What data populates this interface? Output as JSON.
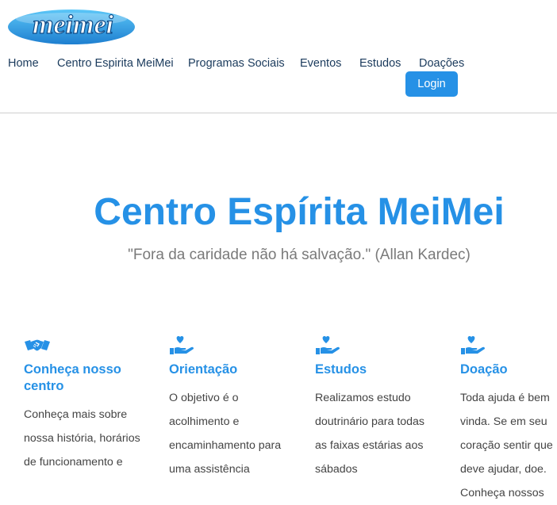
{
  "header": {
    "logo_text": "meimei",
    "nav": [
      "Home",
      "Centro Espirita MeiMei",
      "Programas Sociais",
      "Eventos",
      "Estudos",
      "Doações"
    ],
    "login_label": "Login"
  },
  "hero": {
    "title": "Centro Espírita MeiMei",
    "quote": "\"Fora da caridade não há salvação.\" (Allan Kardec)"
  },
  "features": [
    {
      "icon": "handshake-icon",
      "title": "Conheça nosso centro",
      "text": "Conheça mais sobre nossa história, horários de funcionamento e"
    },
    {
      "icon": "hand-heart-icon",
      "title": "Orientação",
      "text": "O objetivo é o acolhimento e encaminhamento para uma assistência"
    },
    {
      "icon": "hand-heart-icon",
      "title": "Estudos",
      "text": "Realizamos estudo doutrinário para todas as faixas estárias aos sábados"
    },
    {
      "icon": "hand-heart-icon",
      "title": "Doação",
      "text": "Toda ajuda é bem vinda. Se em seu coração sentir que deve ajudar, doe. Conheça nossos"
    }
  ],
  "colors": {
    "accent": "#2691e6",
    "nav_text": "#1a3a5c",
    "quote": "#7a7a7a"
  }
}
